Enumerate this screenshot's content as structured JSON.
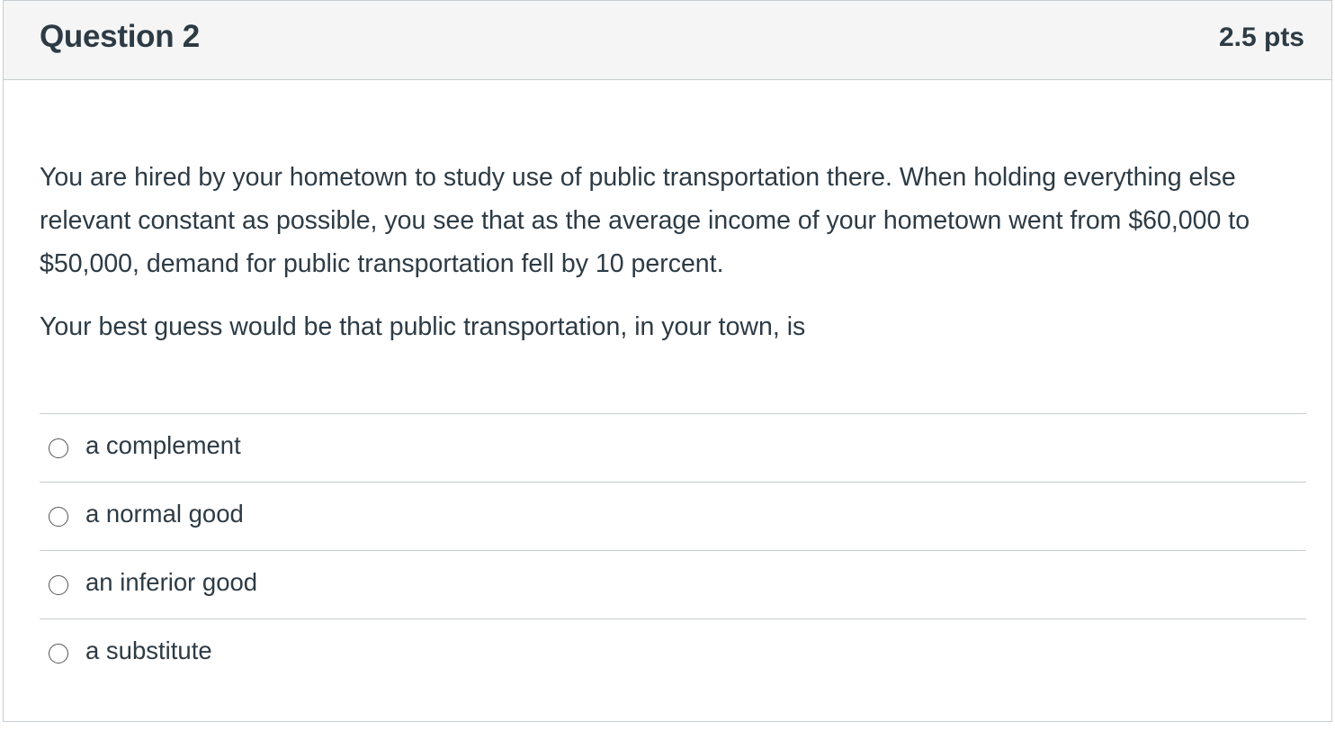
{
  "question": {
    "title": "Question 2",
    "points": "2.5 pts",
    "paragraphs": [
      "You are hired by your hometown to study use of public transportation there.  When holding everything else relevant constant as possible, you see that as the average income of your hometown went from $60,000 to $50,000, demand for public transportation fell by 10 percent.",
      "Your best guess would be that public transportation, in your town, is"
    ],
    "answers": [
      {
        "label": "a complement",
        "selected": false
      },
      {
        "label": "a normal good",
        "selected": false
      },
      {
        "label": "an inferior good",
        "selected": false
      },
      {
        "label": "a substitute",
        "selected": false
      }
    ]
  },
  "icons": {
    "radio": "radio-unchecked-icon"
  },
  "colors": {
    "text": "#2d3b45",
    "header_bg": "#f5f5f5",
    "border": "#c7cdd1"
  }
}
